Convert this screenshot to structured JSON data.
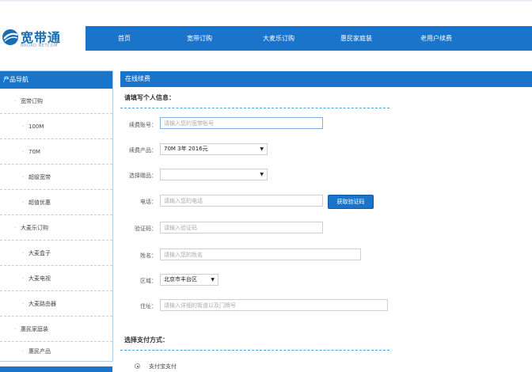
{
  "logo": {
    "text": "宽带通",
    "sub": "BROAD NETCOM"
  },
  "nav": [
    "首页",
    "宽带订购",
    "大麦乐订购",
    "惠民家庭装",
    "老用户续费"
  ],
  "sidebar": {
    "title": "产品导航",
    "items": [
      {
        "label": "宽带订购",
        "level": 1
      },
      {
        "label": "100M",
        "level": 2
      },
      {
        "label": "70M",
        "level": 2
      },
      {
        "label": "超级宽带",
        "level": 2
      },
      {
        "label": "超值优惠",
        "level": 2
      },
      {
        "label": "大麦乐订购",
        "level": 1
      },
      {
        "label": "大麦盒子",
        "level": 2
      },
      {
        "label": "大麦电视",
        "level": 2
      },
      {
        "label": "大麦路由器",
        "level": 2
      },
      {
        "label": "惠民家庭装",
        "level": 1
      },
      {
        "label": "惠民产品",
        "level": 2
      }
    ]
  },
  "main": {
    "title": "在线续费",
    "section_personal": "请填写个人信息：",
    "section_payment": "选择支付方式：",
    "form": {
      "account": {
        "label": "续费账号：",
        "placeholder": "请输入您的宽带账号"
      },
      "product": {
        "label": "续费产品：",
        "value": "70M 3年 2016元"
      },
      "package": {
        "label": "选择赠品：",
        "value": ""
      },
      "phone": {
        "label": "电话：",
        "placeholder": "请输入您的电话"
      },
      "get_code": "获取验证码",
      "code": {
        "label": "验证码：",
        "placeholder": "请输入验证码"
      },
      "name": {
        "label": "姓名：",
        "placeholder": "请输入您的姓名"
      },
      "region": {
        "label": "区域：",
        "value": "北京市丰台区"
      },
      "address": {
        "label": "住址：",
        "placeholder": "请输入详细的街道以及门牌号"
      }
    },
    "payment_option": "支付宝支付"
  }
}
